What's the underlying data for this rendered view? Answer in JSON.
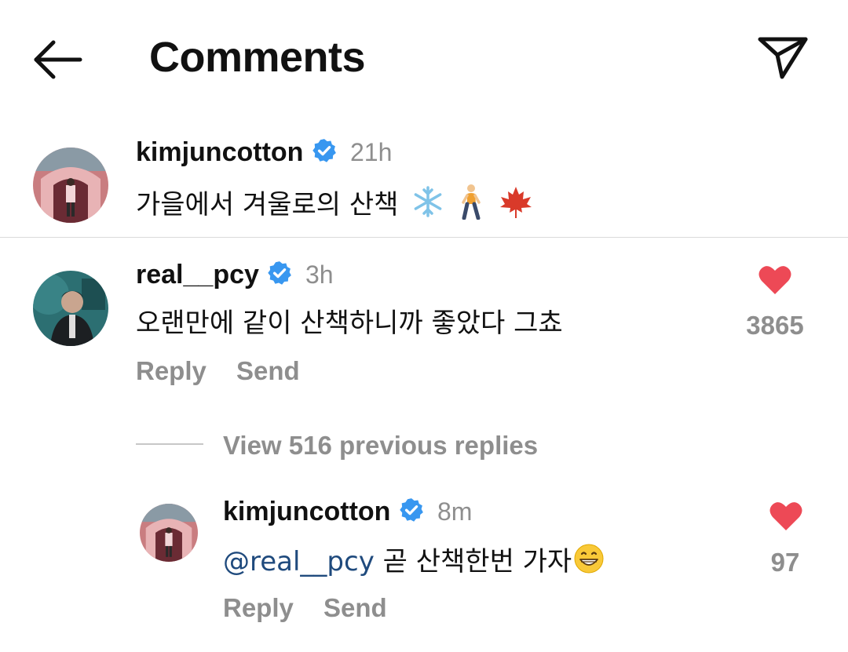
{
  "header": {
    "title": "Comments"
  },
  "caption": {
    "username": "kimjuncotton",
    "timestamp": "21h",
    "text": "가을에서 겨울로의 산책",
    "emojis": [
      "snowflake-icon",
      "walking-person-icon",
      "maple-leaf-icon"
    ]
  },
  "comments": [
    {
      "username": "real__pcy",
      "timestamp": "3h",
      "text": "오랜만에 같이 산책하니까 좋았다 그쵸",
      "likes": "3865",
      "reply_label": "Reply",
      "send_label": "Send"
    }
  ],
  "view_replies": {
    "label": "View 516 previous replies"
  },
  "reply": {
    "username": "kimjuncotton",
    "timestamp": "8m",
    "mention": "@real__pcy",
    "text": " 곧 산책한번 가자",
    "emoji": "grinning-face-icon",
    "likes": "97",
    "reply_label": "Reply",
    "send_label": "Send"
  },
  "colors": {
    "heart": "#ed4956",
    "verified": "#3897f0",
    "mention": "#1f4a7d",
    "muted": "#8e8e8e"
  }
}
